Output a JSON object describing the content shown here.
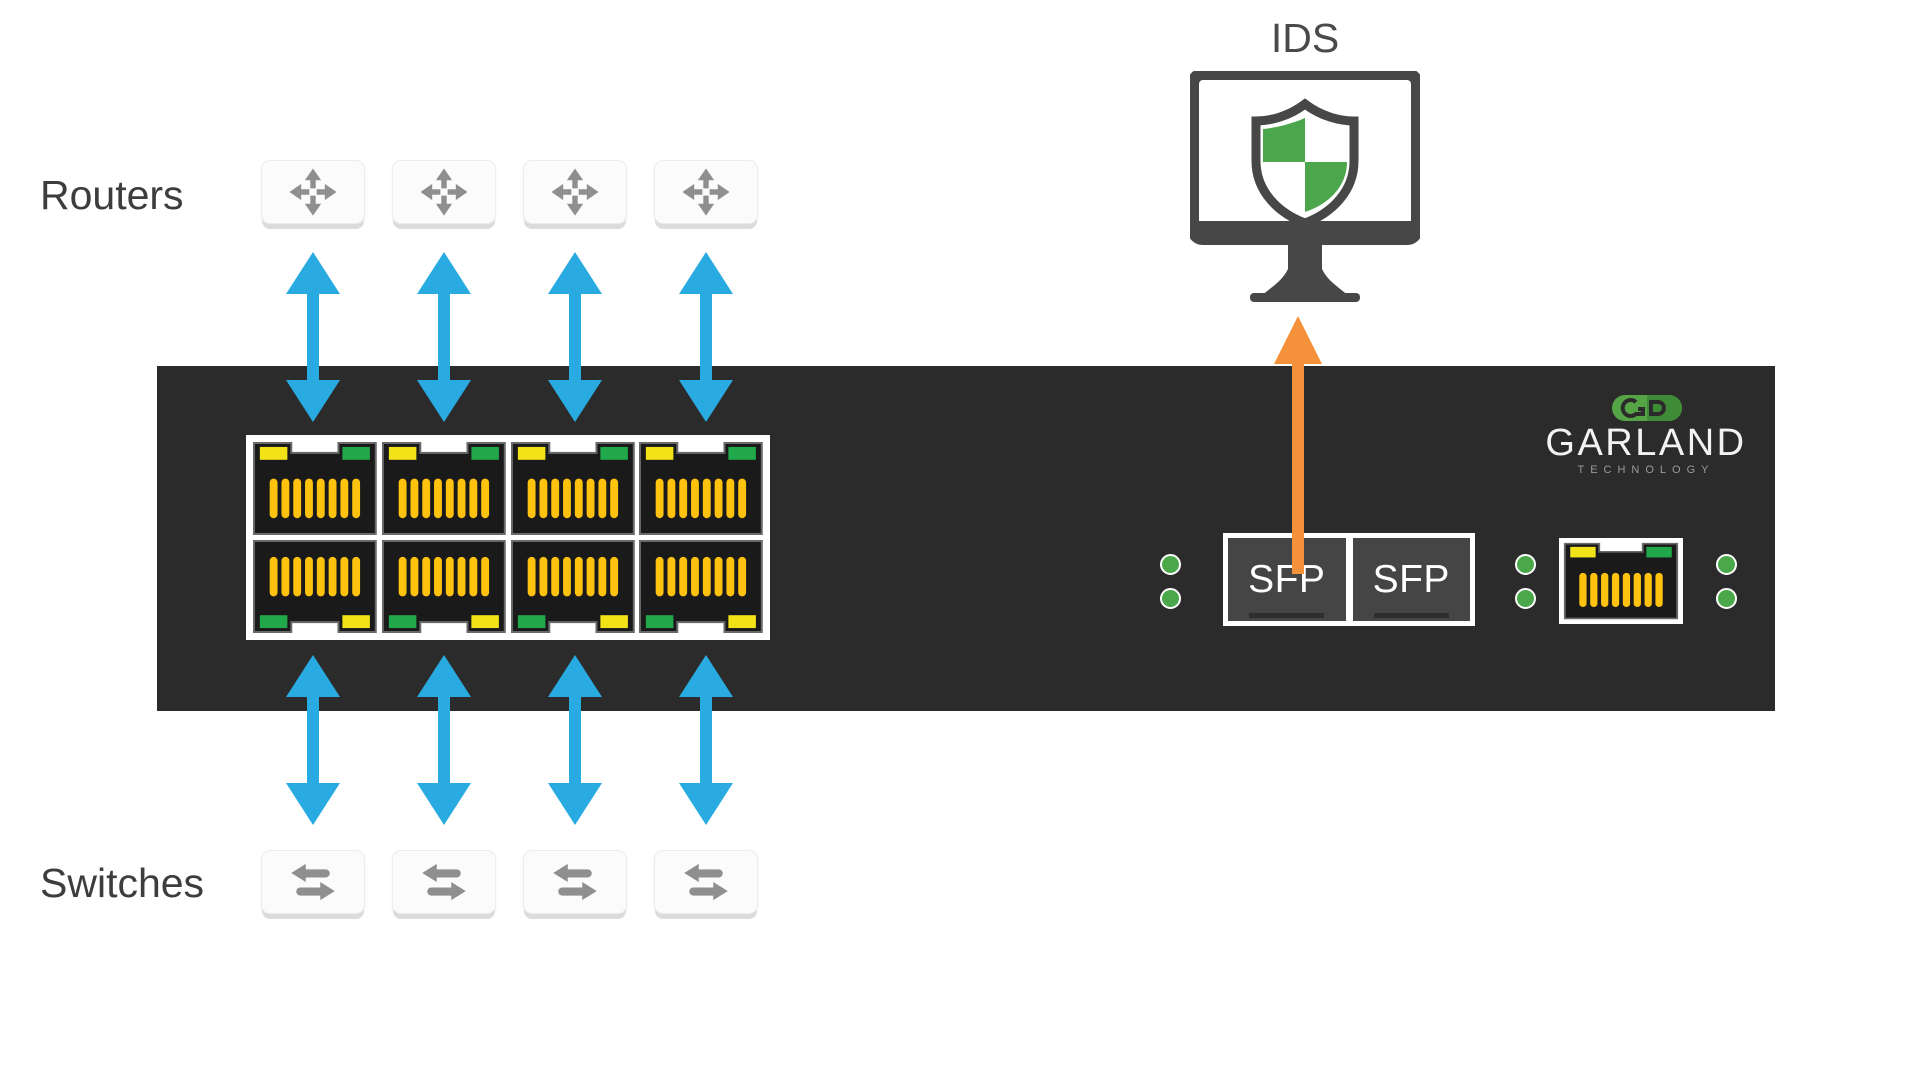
{
  "diagram": {
    "title_ids": "IDS",
    "labels": {
      "routers": "Routers",
      "switches": "Switches"
    },
    "colors": {
      "chassis": "#2b2b2b",
      "link_arrow_blue": "#29ABE2",
      "tap_arrow_orange": "#F5903B",
      "led_green": "#4aa84a",
      "port_led_yellow": "#F2E318",
      "port_led_green": "#21A84A",
      "port_pin_gold": "#FFC20E",
      "brand_green": "#55A546",
      "text_gray": "#4a4a4a",
      "device_icon_gray": "#8f8f8f"
    },
    "brand": {
      "name": "GARLAND",
      "tagline": "TECHNOLOGY",
      "mark": "garland-oval-mark"
    },
    "devices": {
      "routers": [
        {
          "icon": "router-icon",
          "label": ""
        },
        {
          "icon": "router-icon",
          "label": ""
        },
        {
          "icon": "router-icon",
          "label": ""
        },
        {
          "icon": "router-icon",
          "label": ""
        }
      ],
      "switches": [
        {
          "icon": "switch-icon",
          "label": ""
        },
        {
          "icon": "switch-icon",
          "label": ""
        },
        {
          "icon": "switch-icon",
          "label": ""
        },
        {
          "icon": "switch-icon",
          "label": ""
        }
      ]
    },
    "chassis": {
      "rj45_ports": {
        "count": 8,
        "rows": 2,
        "columns": 4,
        "pins_per_port": 8,
        "top_row_led_left": "yellow",
        "top_row_led_right": "green",
        "bottom_row_led_left": "green",
        "bottom_row_led_right": "yellow"
      },
      "sfp_ports": [
        {
          "label": "SFP"
        },
        {
          "label": "SFP"
        }
      ],
      "status_led_groups": [
        {
          "name": "leds-left",
          "count": 2,
          "color": "green"
        },
        {
          "name": "leds-mid",
          "count": 2,
          "color": "green"
        },
        {
          "name": "leds-right",
          "count": 2,
          "color": "green"
        }
      ],
      "management_port": {
        "type": "rj45",
        "led_left": "yellow",
        "led_right": "green",
        "pins": 8
      }
    },
    "connections": {
      "router_links": {
        "count": 4,
        "style": "bidirectional",
        "color": "#29ABE2"
      },
      "switch_links": {
        "count": 4,
        "style": "bidirectional",
        "color": "#29ABE2"
      },
      "monitor_link": {
        "count": 1,
        "style": "unidirectional-up",
        "color": "#F5903B",
        "from": "sfp-port-1",
        "to": "ids-monitor"
      }
    }
  }
}
